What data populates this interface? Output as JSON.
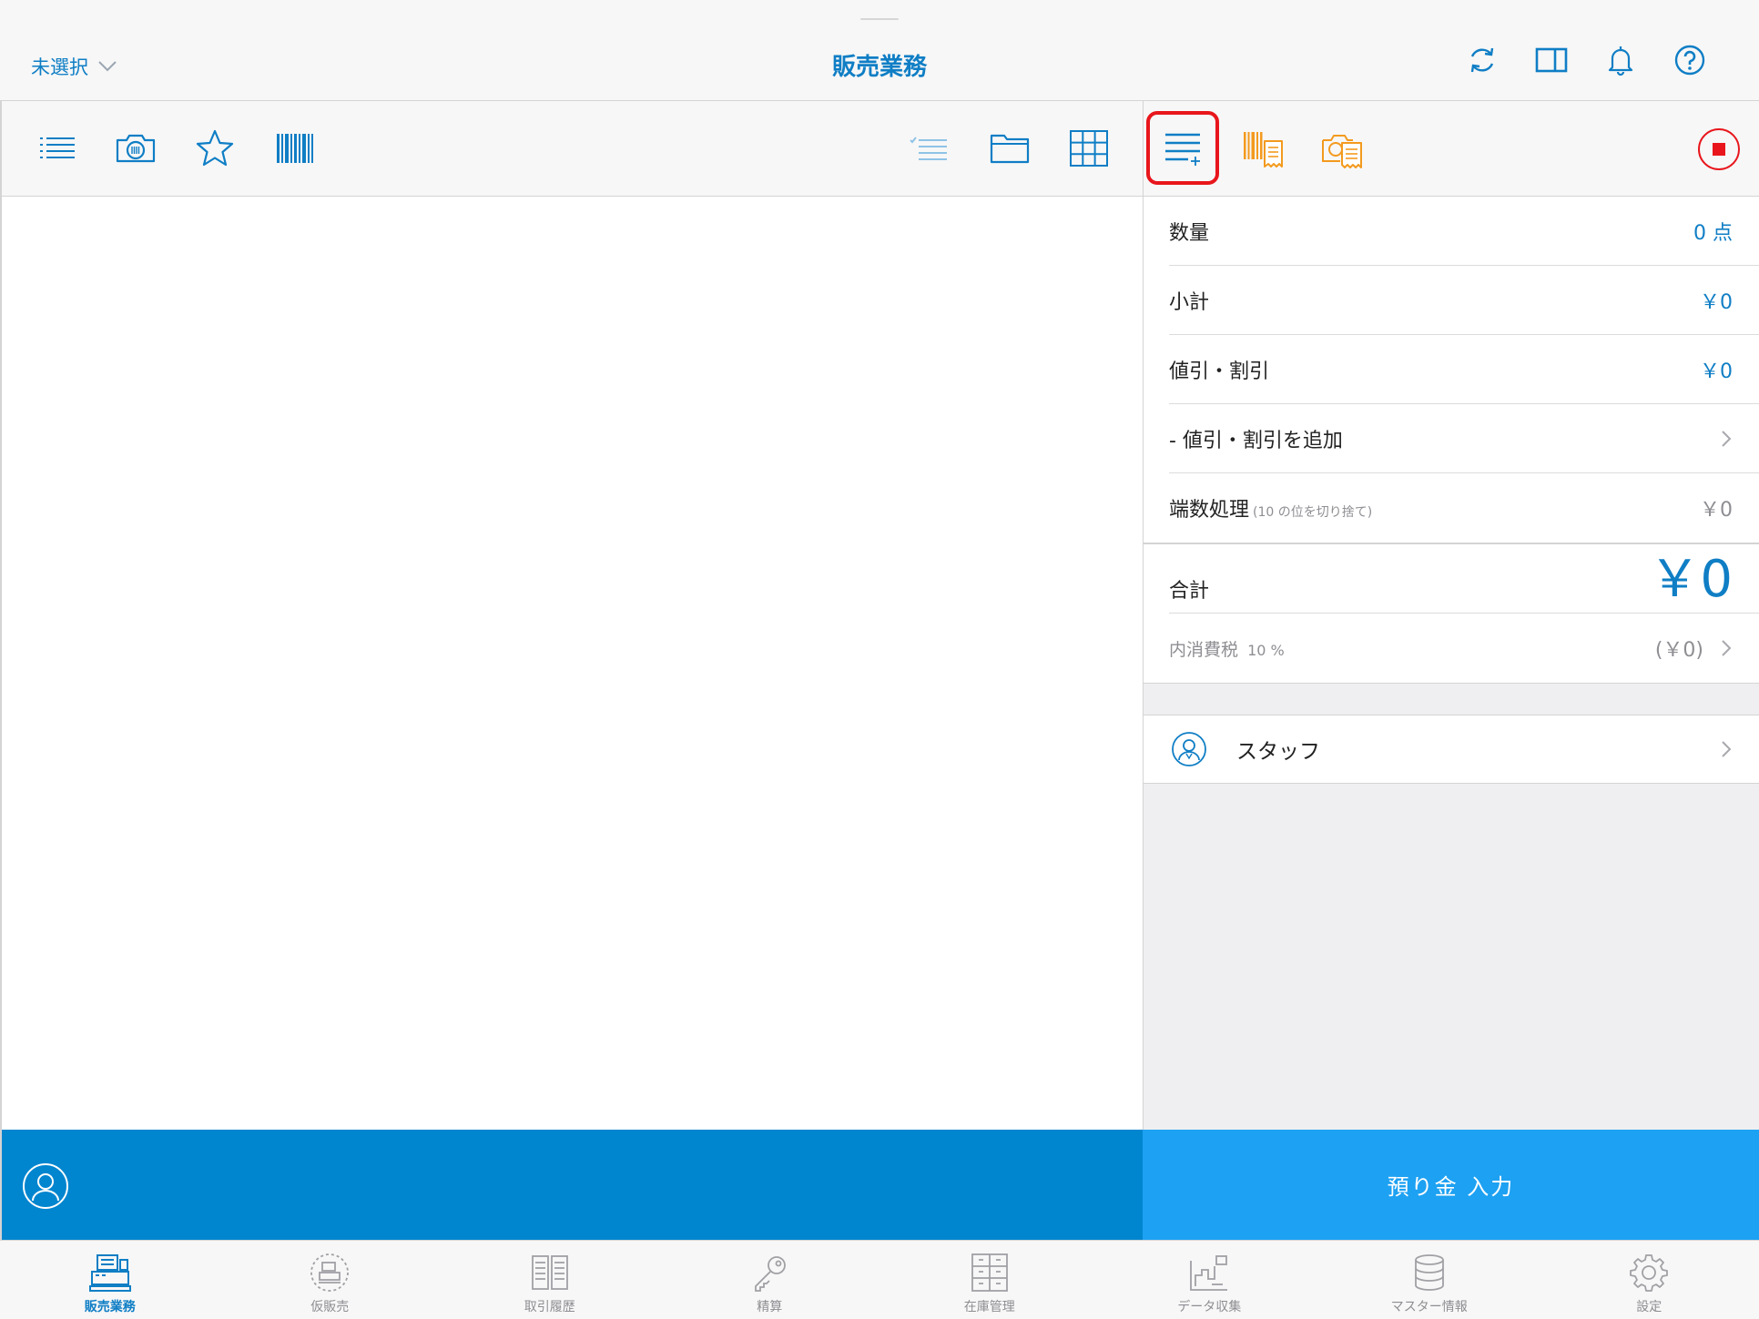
{
  "navbar": {
    "store_selector": "未選択",
    "title": "販売業務"
  },
  "summary": {
    "quantity_label": "数量",
    "quantity_value": "0 点",
    "subtotal_label": "小計",
    "subtotal_value": "￥0",
    "discount_label": "値引・割引",
    "discount_value": "￥0",
    "add_discount_label": "- 値引・割引を追加",
    "rounding_label": "端数処理",
    "rounding_note": "(10 の位を切り捨て)",
    "rounding_value": "￥0",
    "total_label": "合計",
    "total_value": "￥0",
    "tax_label": "内消費税",
    "tax_rate": "10 %",
    "tax_value": "(￥0)"
  },
  "staff": {
    "label": "スタッフ"
  },
  "action": {
    "deposit_label": "預り金 入力"
  },
  "tabs": [
    {
      "label": "販売業務",
      "icon": "register-icon",
      "active": true
    },
    {
      "label": "仮販売",
      "icon": "temp-sale-icon",
      "active": false
    },
    {
      "label": "取引履歴",
      "icon": "history-icon",
      "active": false
    },
    {
      "label": "精算",
      "icon": "key-icon",
      "active": false
    },
    {
      "label": "在庫管理",
      "icon": "inventory-icon",
      "active": false
    },
    {
      "label": "データ収集",
      "icon": "data-collect-icon",
      "active": false
    },
    {
      "label": "マスター情報",
      "icon": "database-icon",
      "active": false
    },
    {
      "label": "設定",
      "icon": "gear-icon",
      "active": false
    }
  ],
  "colors": {
    "accent": "#0f7ec5",
    "action_left": "#0085cf",
    "action_right": "#1da1f2",
    "orange": "#f39a1e",
    "highlight": "#e8161c",
    "stop": "#e8161c"
  }
}
